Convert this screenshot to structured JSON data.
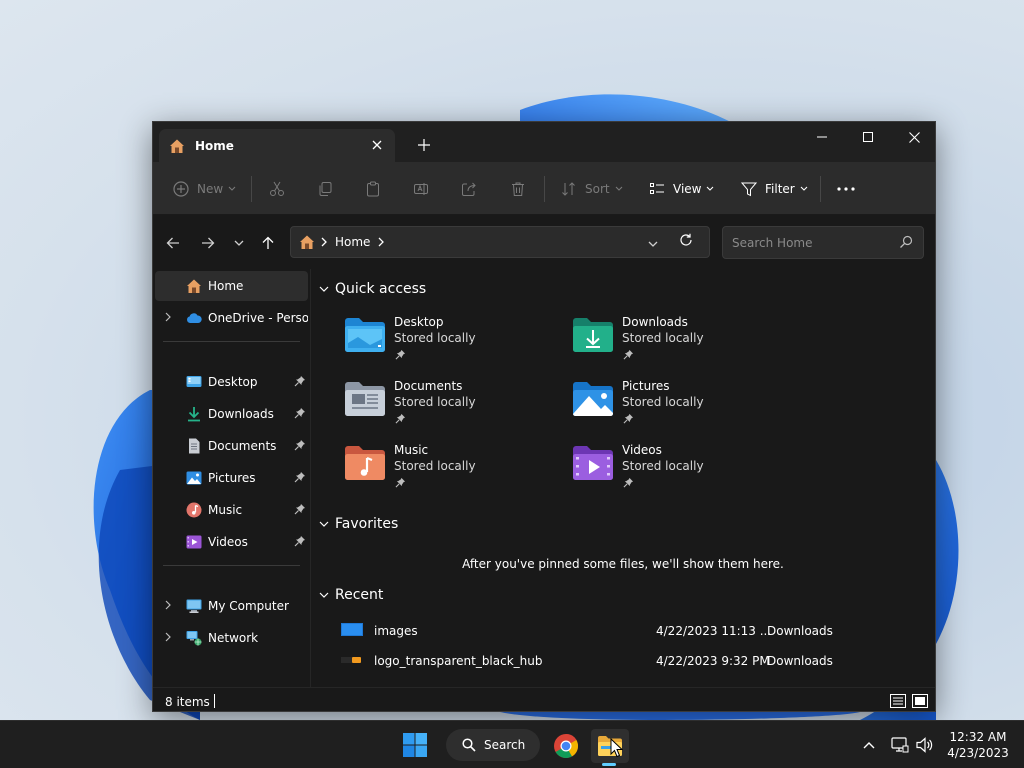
{
  "window": {
    "tab_title": "Home",
    "controls": {
      "minimize": "minimize",
      "maximize": "maximize",
      "close": "close"
    }
  },
  "commandbar": {
    "new_label": "New",
    "sort_label": "Sort",
    "view_label": "View",
    "filter_label": "Filter"
  },
  "address": {
    "path": "Home",
    "search_placeholder": "Search Home"
  },
  "sidebar": {
    "items": [
      {
        "label": "Home",
        "icon": "home-icon",
        "selected": true
      },
      {
        "label": "OneDrive - Personal",
        "icon": "cloud-icon"
      },
      {
        "label": "Desktop",
        "icon": "desktop-icon",
        "pinned": true
      },
      {
        "label": "Downloads",
        "icon": "download-icon",
        "pinned": true
      },
      {
        "label": "Documents",
        "icon": "document-icon",
        "pinned": true
      },
      {
        "label": "Pictures",
        "icon": "picture-icon",
        "pinned": true
      },
      {
        "label": "Music",
        "icon": "music-icon",
        "pinned": true
      },
      {
        "label": "Videos",
        "icon": "video-icon",
        "pinned": true
      },
      {
        "label": "My Computer",
        "icon": "computer-icon"
      },
      {
        "label": "Network",
        "icon": "network-icon"
      }
    ]
  },
  "main": {
    "quick_access": {
      "title": "Quick access",
      "items": [
        {
          "name": "Desktop",
          "sub": "Stored locally"
        },
        {
          "name": "Downloads",
          "sub": "Stored locally"
        },
        {
          "name": "Documents",
          "sub": "Stored locally"
        },
        {
          "name": "Pictures",
          "sub": "Stored locally"
        },
        {
          "name": "Music",
          "sub": "Stored locally"
        },
        {
          "name": "Videos",
          "sub": "Stored locally"
        }
      ]
    },
    "favorites": {
      "title": "Favorites",
      "empty_message": "After you've pinned some files, we'll show them here."
    },
    "recent": {
      "title": "Recent",
      "rows": [
        {
          "name": "images",
          "date": "4/22/2023 11:13 ...",
          "location": "Downloads"
        },
        {
          "name": "logo_transparent_black_hub",
          "date": "4/22/2023 9:32 PM",
          "location": "Downloads"
        }
      ]
    }
  },
  "status": {
    "items": "8 items"
  },
  "taskbar": {
    "search_label": "Search",
    "time": "12:32 AM",
    "date": "4/23/2023"
  },
  "colors": {
    "accent": "#60cdff",
    "window_bg": "#191919",
    "commandbar_bg": "#2c2c2c",
    "folder_blue": "#3aa0e8",
    "folder_green": "#1fa57a"
  }
}
